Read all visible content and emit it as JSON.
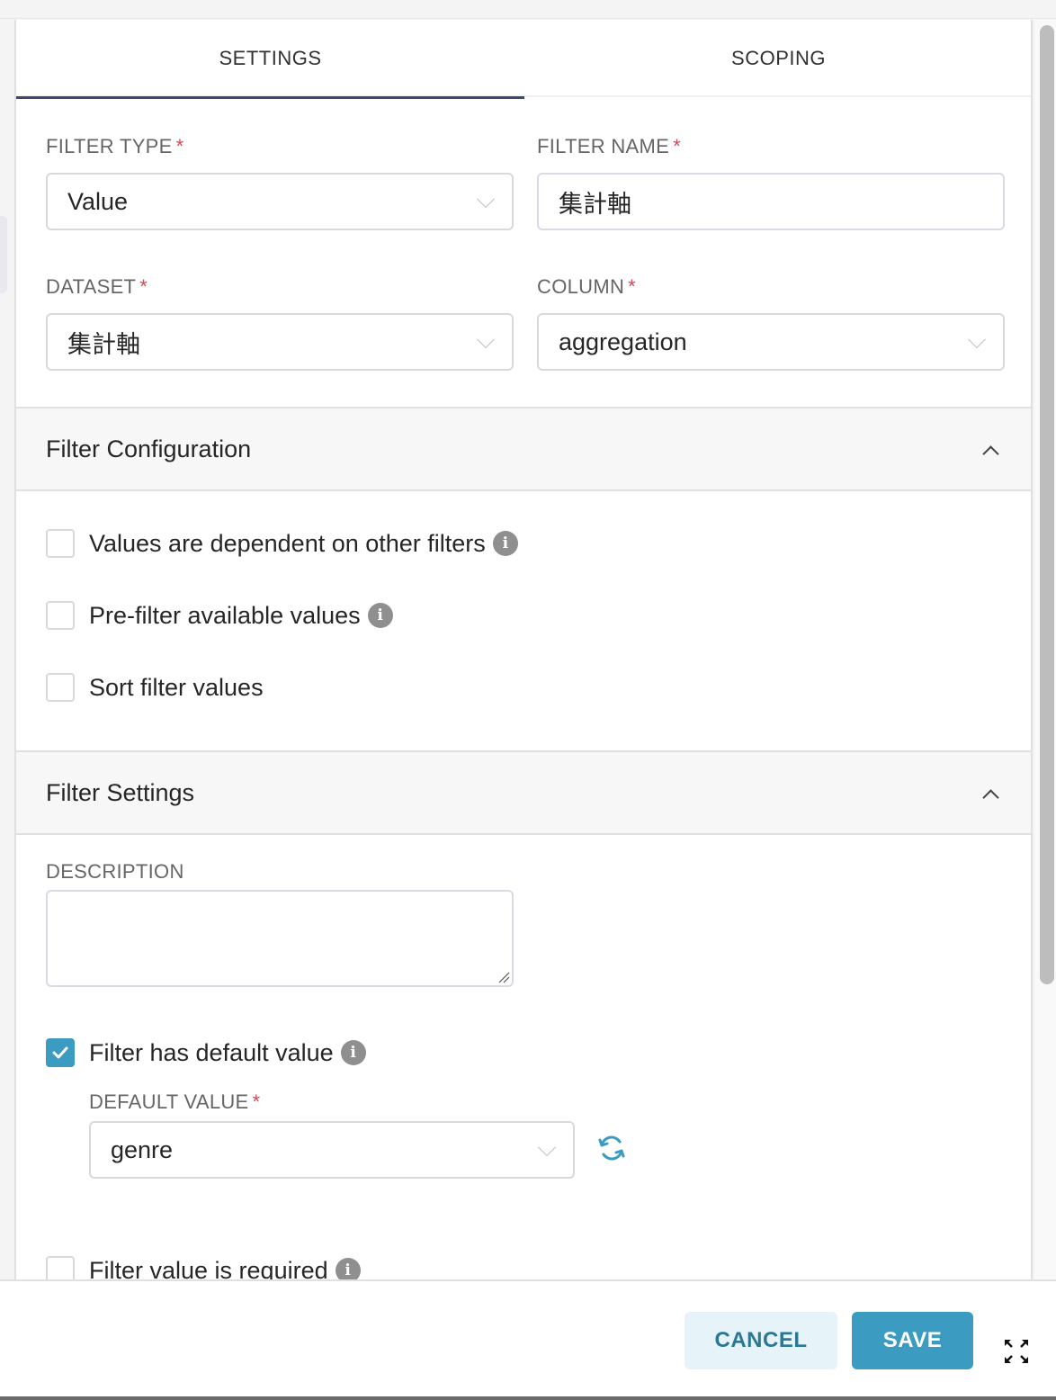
{
  "tabs": [
    {
      "label": "SETTINGS",
      "active": true
    },
    {
      "label": "SCOPING",
      "active": false
    }
  ],
  "fields": {
    "filter_type": {
      "label": "FILTER TYPE",
      "required_mark": "*",
      "value": "Value"
    },
    "filter_name": {
      "label": "FILTER NAME",
      "required_mark": "*",
      "value": "集計軸"
    },
    "dataset": {
      "label": "DATASET",
      "required_mark": "*",
      "value": "集計軸"
    },
    "column": {
      "label": "COLUMN",
      "required_mark": "*",
      "value": "aggregation"
    }
  },
  "filter_configuration": {
    "title": "Filter Configuration",
    "options": [
      {
        "label": "Values are dependent on other filters",
        "checked": false,
        "has_info": true
      },
      {
        "label": "Pre-filter available values",
        "checked": false,
        "has_info": true
      },
      {
        "label": "Sort filter values",
        "checked": false,
        "has_info": false
      }
    ]
  },
  "filter_settings": {
    "title": "Filter Settings",
    "description": {
      "label": "DESCRIPTION",
      "value": ""
    },
    "has_default": {
      "label": "Filter has default value",
      "checked": true
    },
    "default_value": {
      "label": "DEFAULT VALUE",
      "required_mark": "*",
      "value": "genre"
    },
    "value_required": {
      "label": "Filter value is required",
      "checked": false
    }
  },
  "footer": {
    "cancel_label": "CANCEL",
    "save_label": "SAVE"
  },
  "icons": {
    "info": "i"
  },
  "colors": {
    "accent": "#3b9bc0",
    "tab_indicator": "#3d4871",
    "required": "#e04355",
    "cancel_bg": "#e6f3f8",
    "cancel_text": "#2c7793"
  }
}
